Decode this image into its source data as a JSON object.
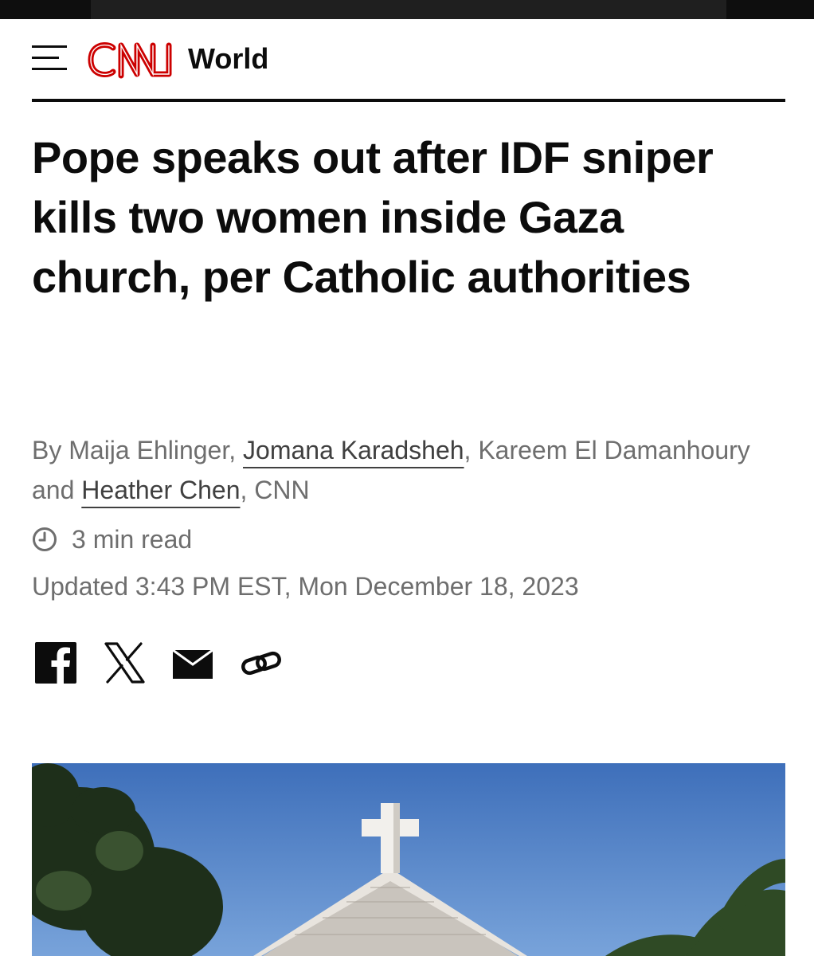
{
  "header": {
    "logo_text": "CNN",
    "section": "World"
  },
  "article": {
    "headline": "Pope speaks out after IDF sniper kills two women inside Gaza church, per Catholic authorities",
    "byline": {
      "prefix": "By Maija Ehlinger,",
      "author_link_1": "Jomana Karadsheh",
      "middle": ", Kareem El Damanhoury and",
      "author_link_2": "Heather Chen",
      "suffix": ", CNN"
    },
    "read_time": "3 min read",
    "updated": "Updated 3:43 PM EST, Mon December 18, 2023"
  },
  "share": {
    "icons": [
      "facebook-icon",
      "x-icon",
      "email-icon",
      "link-icon"
    ]
  },
  "colors": {
    "brand_red": "#cc0000",
    "text": "#0c0c0c",
    "meta_gray": "#6e6e6e",
    "sky_blue": "#4f7fc4"
  }
}
